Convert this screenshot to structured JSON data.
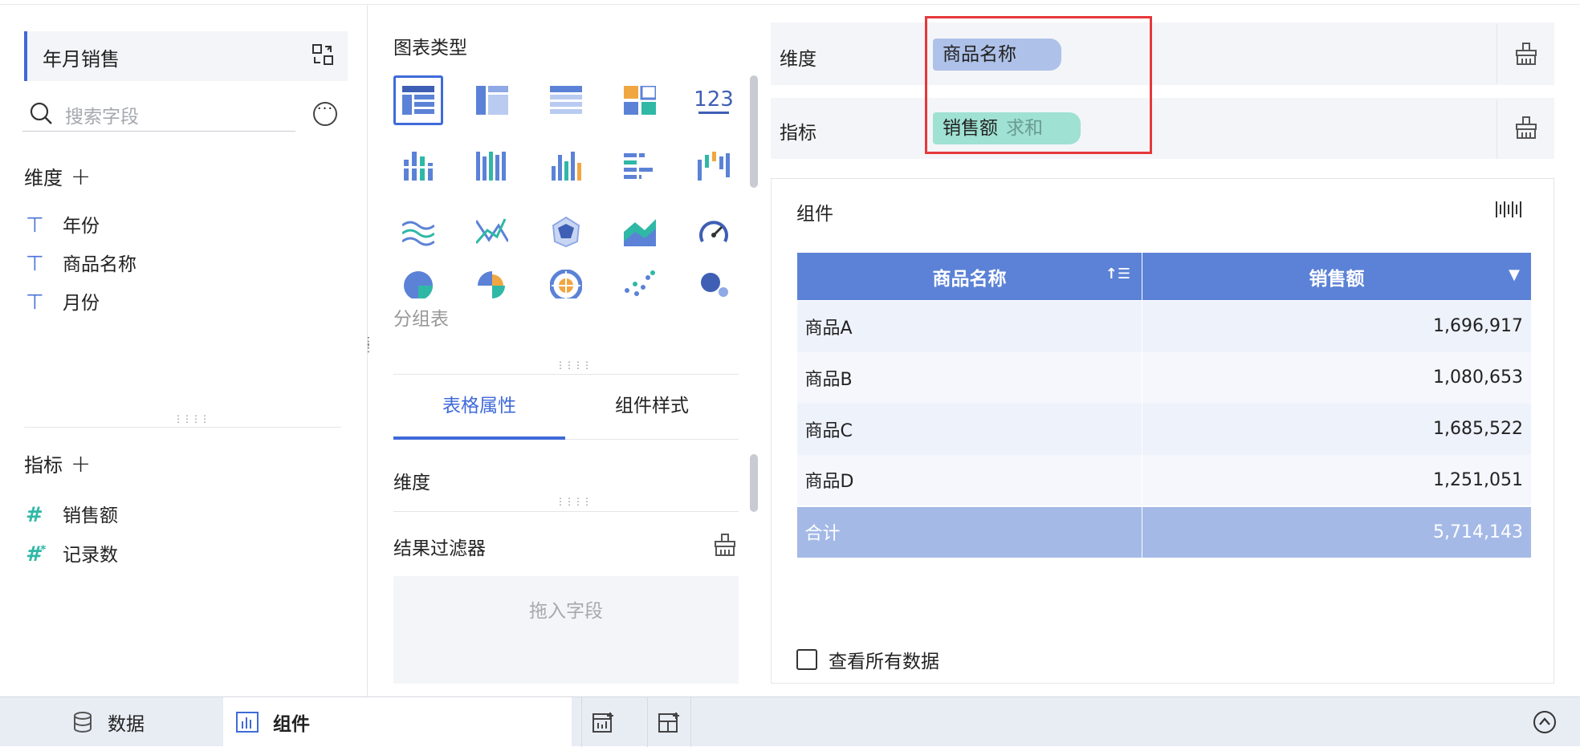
{
  "datasource": {
    "name": "年月销售"
  },
  "search": {
    "placeholder": "搜索字段"
  },
  "dimensions": {
    "title": "维度",
    "add": "+",
    "items": [
      "年份",
      "商品名称",
      "月份"
    ]
  },
  "measures": {
    "title": "指标",
    "add": "+",
    "items": [
      "销售额",
      "记录数"
    ]
  },
  "chart_types": {
    "title": "图表类型",
    "selected_label": "分组表",
    "kpi_text": "123"
  },
  "prop_tabs": {
    "active": "表格属性",
    "other": "组件样式"
  },
  "props": {
    "dimension_label": "维度",
    "filter_label": "结果过滤器",
    "drop_hint": "拖入字段"
  },
  "shelves": {
    "dimension": {
      "label": "维度",
      "field": "商品名称"
    },
    "measure": {
      "label": "指标",
      "field": "销售额",
      "agg": "求和"
    }
  },
  "component": {
    "title": "组件",
    "columns": [
      "商品名称",
      "销售额"
    ],
    "rows": [
      {
        "name": "商品A",
        "value": "1,696,917"
      },
      {
        "name": "商品B",
        "value": "1,080,653"
      },
      {
        "name": "商品C",
        "value": "1,685,522"
      },
      {
        "name": "商品D",
        "value": "1,251,051"
      }
    ],
    "total": {
      "name": "合计",
      "value": "5,714,143"
    },
    "view_all": "查看所有数据"
  },
  "bottom": {
    "data_tab": "数据",
    "component_tab": "组件"
  },
  "colors": {
    "accent": "#3f6ad8",
    "header": "#5b82d6",
    "highlight": "#e5383b"
  }
}
